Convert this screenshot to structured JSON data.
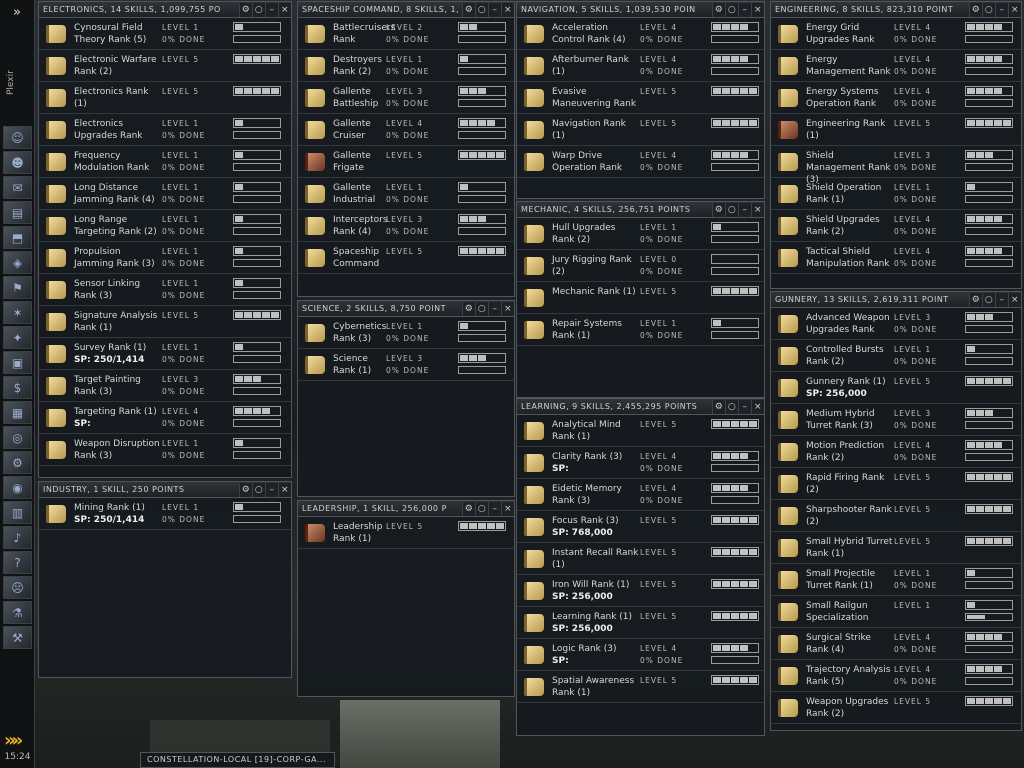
{
  "neocom": {
    "top_label": "»",
    "name": "Plexir",
    "icons": [
      "character-icon",
      "people-icon",
      "mail-icon",
      "notepad-icon",
      "cargo-icon",
      "market-icon",
      "corporation-icon",
      "map-icon",
      "star-map-icon",
      "assets-icon",
      "wallet-icon",
      "calculator-icon",
      "help-lifebuoy-icon",
      "fitting-icon",
      "browser-icon",
      "journal-icon",
      "audio-icon",
      "info-icon",
      "portrait-icon",
      "science-icon",
      "industry-icon"
    ],
    "arrow": "»»",
    "clock": "15:24"
  },
  "windows": [
    {
      "id": "electronics",
      "title": "ELECTRONICS, 14 SKILLS, 1,099,755 PO",
      "skills": [
        {
          "name": "Cynosural Field Theory Rank (5)",
          "level": "LEVEL 1",
          "done": "0% DONE",
          "lv": 1,
          "pct": 0
        },
        {
          "name": "Electronic Warfare Rank (2)",
          "level": "LEVEL 5",
          "done": "",
          "lv": 5,
          "pct": 0
        },
        {
          "name": "Electronics Rank (1)",
          "level": "LEVEL 5",
          "done": "",
          "lv": 5,
          "pct": 0
        },
        {
          "name": "Electronics Upgrades Rank",
          "level": "LEVEL 1",
          "done": "0% DONE",
          "lv": 1,
          "pct": 0
        },
        {
          "name": "Frequency Modulation Rank",
          "level": "LEVEL 1",
          "done": "0% DONE",
          "lv": 1,
          "pct": 0
        },
        {
          "name": "Long Distance Jamming Rank (4)",
          "level": "LEVEL 1",
          "done": "0% DONE",
          "lv": 1,
          "pct": 0
        },
        {
          "name": "Long Range Targeting Rank (2)",
          "level": "LEVEL 1",
          "done": "0% DONE",
          "lv": 1,
          "pct": 0
        },
        {
          "name": "Propulsion Jamming Rank (3)",
          "level": "LEVEL 1",
          "done": "0% DONE",
          "lv": 1,
          "pct": 0
        },
        {
          "name": "Sensor Linking Rank (3)",
          "level": "LEVEL 1",
          "done": "0% DONE",
          "lv": 1,
          "pct": 0
        },
        {
          "name": "Signature Analysis Rank (1)",
          "level": "LEVEL 5",
          "done": "",
          "lv": 5,
          "pct": 0
        },
        {
          "name": "Survey Rank (1)",
          "sp": "SP: 250/1,414",
          "level": "LEVEL 1",
          "done": "0% DONE",
          "lv": 1,
          "pct": 0
        },
        {
          "name": "Target Painting Rank (3)",
          "level": "LEVEL 3",
          "done": "0% DONE",
          "lv": 3,
          "pct": 0
        },
        {
          "name": "Targeting Rank (1)",
          "sp": "SP:",
          "level": "LEVEL 4",
          "done": "0% DONE",
          "lv": 4,
          "pct": 0
        },
        {
          "name": "Weapon Disruption Rank (3)",
          "level": "LEVEL 1",
          "done": "0% DONE",
          "lv": 1,
          "pct": 0
        }
      ]
    },
    {
      "id": "industry",
      "title": "INDUSTRY, 1 SKILL, 250 POINTS",
      "skills": [
        {
          "name": "Mining Rank (1)",
          "sp": "SP: 250/1,414",
          "level": "LEVEL 1",
          "done": "0% DONE",
          "lv": 1,
          "pct": 0
        }
      ]
    },
    {
      "id": "spaceship",
      "title": "SPACESHIP COMMAND, 8 SKILLS, 1,",
      "skills": [
        {
          "name": "Battlecruisers Rank",
          "level": "LEVEL 2",
          "done": "0% DONE",
          "lv": 2,
          "pct": 0
        },
        {
          "name": "Destroyers Rank (2)",
          "level": "LEVEL 1",
          "done": "0% DONE",
          "lv": 1,
          "pct": 0
        },
        {
          "name": "Gallente Battleship",
          "level": "LEVEL 3",
          "done": "0% DONE",
          "lv": 3,
          "pct": 0
        },
        {
          "name": "Gallente Cruiser",
          "level": "LEVEL 4",
          "done": "0% DONE",
          "lv": 4,
          "pct": 0
        },
        {
          "name": "Gallente Frigate",
          "level": "LEVEL 5",
          "done": "",
          "lv": 5,
          "pct": 0,
          "red": true
        },
        {
          "name": "Gallente Industrial",
          "level": "LEVEL 1",
          "done": "0% DONE",
          "lv": 1,
          "pct": 0
        },
        {
          "name": "Interceptors Rank (4)",
          "level": "LEVEL 3",
          "done": "0% DONE",
          "lv": 3,
          "pct": 0
        },
        {
          "name": "Spaceship Command",
          "level": "LEVEL 5",
          "done": "",
          "lv": 5,
          "pct": 0
        }
      ]
    },
    {
      "id": "science",
      "title": "SCIENCE, 2 SKILLS, 8,750 POINT",
      "skills": [
        {
          "name": "Cybernetics Rank (3)",
          "level": "LEVEL 1",
          "done": "0% DONE",
          "lv": 1,
          "pct": 0
        },
        {
          "name": "Science Rank (1)",
          "level": "LEVEL 3",
          "done": "0% DONE",
          "lv": 3,
          "pct": 0
        }
      ]
    },
    {
      "id": "leadership",
      "title": "LEADERSHIP, 1 SKILL, 256,000 P",
      "skills": [
        {
          "name": "Leadership Rank (1)",
          "level": "LEVEL 5",
          "done": "",
          "lv": 5,
          "pct": 0,
          "red": true
        }
      ]
    },
    {
      "id": "navigation",
      "title": "NAVIGATION, 5 SKILLS, 1,039,530 POIN",
      "skills": [
        {
          "name": "Acceleration Control Rank (4)",
          "level": "LEVEL 4",
          "done": "0% DONE",
          "lv": 4,
          "pct": 0
        },
        {
          "name": "Afterburner Rank (1)",
          "level": "LEVEL 4",
          "done": "0% DONE",
          "lv": 4,
          "pct": 0
        },
        {
          "name": "Evasive Maneuvering Rank",
          "level": "LEVEL 5",
          "done": "",
          "lv": 5,
          "pct": 0
        },
        {
          "name": "Navigation Rank (1)",
          "level": "LEVEL 5",
          "done": "",
          "lv": 5,
          "pct": 0
        },
        {
          "name": "Warp Drive Operation Rank",
          "level": "LEVEL 4",
          "done": "0% DONE",
          "lv": 4,
          "pct": 0
        }
      ]
    },
    {
      "id": "mechanic",
      "title": "MECHANIC, 4 SKILLS, 256,751 POINTS",
      "skills": [
        {
          "name": "Hull Upgrades Rank (2)",
          "level": "LEVEL 1",
          "done": "0% DONE",
          "lv": 1,
          "pct": 0
        },
        {
          "name": "Jury Rigging Rank (2)",
          "level": "LEVEL 0",
          "done": "0% DONE",
          "lv": 0,
          "pct": 0
        },
        {
          "name": "Mechanic Rank (1)",
          "level": "LEVEL 5",
          "done": "",
          "lv": 5,
          "pct": 0
        },
        {
          "name": "Repair Systems Rank (1)",
          "level": "LEVEL 1",
          "done": "0% DONE",
          "lv": 1,
          "pct": 0
        }
      ]
    },
    {
      "id": "learning",
      "title": "LEARNING, 9 SKILLS, 2,455,295 POINTS",
      "skills": [
        {
          "name": "Analytical Mind Rank (1)",
          "level": "LEVEL 5",
          "done": "",
          "lv": 5,
          "pct": 0
        },
        {
          "name": "Clarity Rank (3)",
          "sp": "SP:",
          "level": "LEVEL 4",
          "done": "0% DONE",
          "lv": 4,
          "pct": 0
        },
        {
          "name": "Eidetic Memory Rank (3)",
          "level": "LEVEL 4",
          "done": "0% DONE",
          "lv": 4,
          "pct": 0
        },
        {
          "name": "Focus Rank (3)",
          "sp": "SP: 768,000",
          "level": "LEVEL 5",
          "done": "",
          "lv": 5,
          "pct": 0
        },
        {
          "name": "Instant Recall Rank (1)",
          "level": "LEVEL 5",
          "done": "",
          "lv": 5,
          "pct": 0
        },
        {
          "name": "Iron Will Rank (1)",
          "sp": "SP: 256,000",
          "level": "LEVEL 5",
          "done": "",
          "lv": 5,
          "pct": 0
        },
        {
          "name": "Learning Rank (1)",
          "sp": "SP: 256,000",
          "level": "LEVEL 5",
          "done": "",
          "lv": 5,
          "pct": 0
        },
        {
          "name": "Logic Rank (3)",
          "sp": "SP:",
          "level": "LEVEL 4",
          "done": "0% DONE",
          "lv": 4,
          "pct": 0
        },
        {
          "name": "Spatial Awareness Rank (1)",
          "level": "LEVEL 5",
          "done": "",
          "lv": 5,
          "pct": 0
        }
      ]
    },
    {
      "id": "engineering",
      "title": "ENGINEERING, 8 SKILLS, 823,310 POINT",
      "skills": [
        {
          "name": "Energy Grid Upgrades Rank",
          "level": "LEVEL 4",
          "done": "0% DONE",
          "lv": 4,
          "pct": 0
        },
        {
          "name": "Energy Management Rank",
          "level": "LEVEL 4",
          "done": "0% DONE",
          "lv": 4,
          "pct": 0
        },
        {
          "name": "Energy Systems Operation Rank",
          "level": "LEVEL 4",
          "done": "0% DONE",
          "lv": 4,
          "pct": 0
        },
        {
          "name": "Engineering Rank (1)",
          "level": "LEVEL 5",
          "done": "",
          "lv": 5,
          "pct": 0,
          "red": true
        },
        {
          "name": "Shield Management Rank (3)",
          "level": "LEVEL 3",
          "done": "0% DONE",
          "lv": 3,
          "pct": 0
        },
        {
          "name": "Shield Operation Rank (1)",
          "level": "LEVEL 1",
          "done": "0% DONE",
          "lv": 1,
          "pct": 0
        },
        {
          "name": "Shield Upgrades Rank (2)",
          "level": "LEVEL 4",
          "done": "0% DONE",
          "lv": 4,
          "pct": 0
        },
        {
          "name": "Tactical Shield Manipulation Rank",
          "level": "LEVEL 4",
          "done": "0% DONE",
          "lv": 4,
          "pct": 0
        }
      ]
    },
    {
      "id": "gunnery",
      "title": "GUNNERY, 13 SKILLS, 2,619,311 POINT",
      "skills": [
        {
          "name": "Advanced Weapon Upgrades Rank",
          "level": "LEVEL 3",
          "done": "0% DONE",
          "lv": 3,
          "pct": 0
        },
        {
          "name": "Controlled Bursts Rank (2)",
          "level": "LEVEL 1",
          "done": "0% DONE",
          "lv": 1,
          "pct": 0
        },
        {
          "name": "Gunnery Rank (1)",
          "sp": "SP: 256,000",
          "level": "LEVEL 5",
          "done": "",
          "lv": 5,
          "pct": 0
        },
        {
          "name": "Medium Hybrid Turret Rank (3)",
          "level": "LEVEL 3",
          "done": "0% DONE",
          "lv": 3,
          "pct": 0
        },
        {
          "name": "Motion Prediction Rank (2)",
          "level": "LEVEL 4",
          "done": "0% DONE",
          "lv": 4,
          "pct": 0
        },
        {
          "name": "Rapid Firing Rank (2)",
          "level": "LEVEL 5",
          "done": "",
          "lv": 5,
          "pct": 0
        },
        {
          "name": "Sharpshooter Rank (2)",
          "level": "LEVEL 5",
          "done": "",
          "lv": 5,
          "pct": 0
        },
        {
          "name": "Small Hybrid Turret Rank (1)",
          "level": "LEVEL 5",
          "done": "",
          "lv": 5,
          "pct": 0
        },
        {
          "name": "Small Projectile Turret Rank (1)",
          "level": "LEVEL 1",
          "done": "0% DONE",
          "lv": 1,
          "pct": 0
        },
        {
          "name": "Small Railgun Specialization",
          "level": "LEVEL 1",
          "done": "",
          "lv": 1,
          "pct": 0.4
        },
        {
          "name": "Surgical Strike Rank (4)",
          "level": "LEVEL 4",
          "done": "0% DONE",
          "lv": 4,
          "pct": 0
        },
        {
          "name": "Trajectory Analysis Rank (5)",
          "level": "LEVEL 4",
          "done": "0% DONE",
          "lv": 4,
          "pct": 0
        },
        {
          "name": "Weapon Upgrades Rank (2)",
          "level": "LEVEL 5",
          "done": "",
          "lv": 5,
          "pct": 0
        }
      ]
    }
  ],
  "window_controls": [
    "⚙",
    "○",
    "–",
    "×"
  ],
  "chat_tab": "CONSTELLATION-LOCAL [19]-CORP-GA..."
}
